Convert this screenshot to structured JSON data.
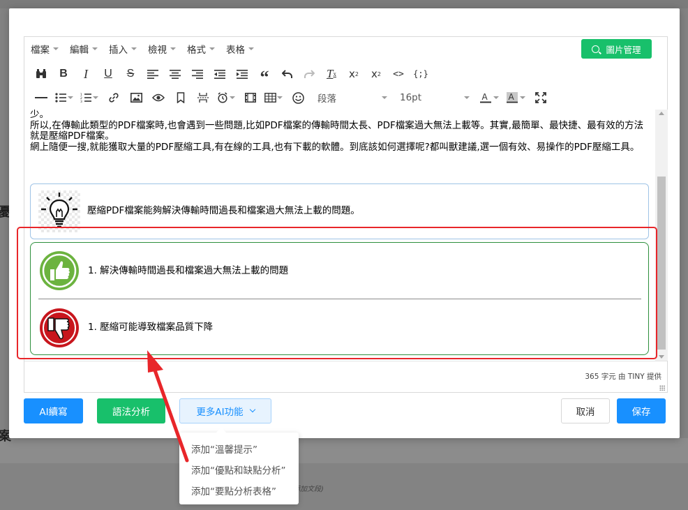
{
  "background": {
    "heading_fragment": "憂",
    "footer_heading_fragment": "案",
    "footer_note_fragment": "添加文段)"
  },
  "menubar": {
    "items": [
      "檔案",
      "編輯",
      "插入",
      "檢視",
      "格式",
      "表格"
    ],
    "image_manager_label": "圖片管理"
  },
  "toolbar": {
    "row1_icons": [
      "find-replace-icon",
      "bold-icon",
      "italic-icon",
      "underline-icon",
      "strikethrough-icon",
      "align-left-icon",
      "align-center-icon",
      "align-right-icon",
      "outdent-icon",
      "indent-icon",
      "blockquote-icon",
      "undo-icon",
      "redo-icon",
      "clear-format-icon",
      "subscript-icon",
      "superscript-icon",
      "code-icon",
      "code-sample-icon"
    ],
    "block_format": "段落",
    "font_size": "16pt"
  },
  "content": {
    "paragraphs": [
      "少。",
      "所以,在傳輸此類型的PDF檔案時,也會遇到一些問題,比如PDF檔案的傳輸時間太長、PDF檔案過大無法上載等。其實,最簡單、最快捷、最有效的方法就是壓縮PDF檔案。",
      "網上隨便一搜,就能獲取大量的PDF壓縮工具,有在線的工具,也有下載的軟體。到底該如何選擇呢?都叫獸建議,選一個有效、易操作的PDF壓縮工具。"
    ],
    "tip_text": "壓縮PDF檔案能夠解決傳輸時間過長和檔案過大無法上載的問題。",
    "pro_text": "1. 解決傳輸時間過長和檔案過大無法上載的問題",
    "con_text": "1. 壓縮可能導致檔案品質下降"
  },
  "status": {
    "text": "365 字元 由 TINY 提供"
  },
  "buttons": {
    "ai_write": "AI續寫",
    "grammar": "語法分析",
    "more_ai": "更多AI功能",
    "cancel": "取消",
    "save": "保存"
  },
  "dropdown": {
    "items": [
      "添加“溫馨提示”",
      "添加“優點和缺點分析”",
      "添加“要點分析表格”"
    ]
  },
  "colors": {
    "primary": "#1890ff",
    "green": "#18c06b",
    "highlight_red": "#e8262a"
  }
}
